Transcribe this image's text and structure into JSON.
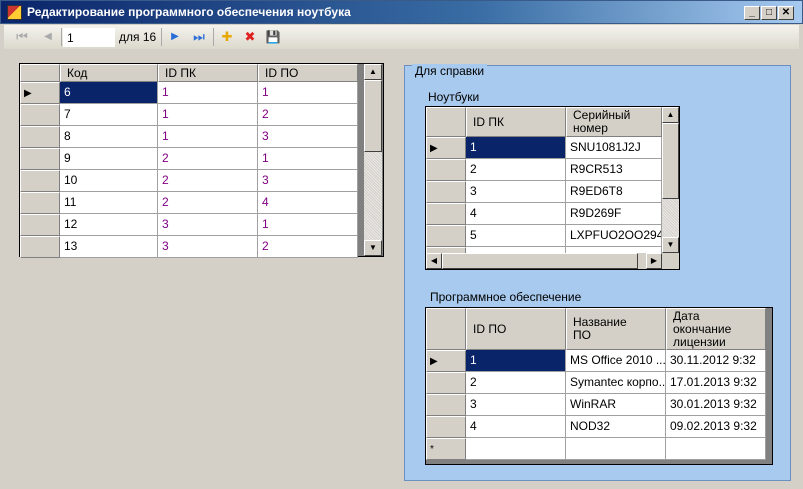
{
  "window": {
    "title": "Редактирование программного обеспечения ноутбука",
    "minimize": "_",
    "maximize": "□",
    "close": "✕"
  },
  "toolbar": {
    "first": "⏮",
    "prev": "◀",
    "position": "1",
    "of_label": "для 16",
    "next": "▶",
    "last": "⏭",
    "add": "✚",
    "delete": "✖",
    "save": "💾"
  },
  "main_grid": {
    "columns": [
      "Код",
      "ID ПК",
      "ID ПО"
    ],
    "rows": [
      [
        "6",
        "1",
        "1"
      ],
      [
        "7",
        "1",
        "2"
      ],
      [
        "8",
        "1",
        "3"
      ],
      [
        "9",
        "2",
        "1"
      ],
      [
        "10",
        "2",
        "3"
      ],
      [
        "11",
        "2",
        "4"
      ],
      [
        "12",
        "3",
        "1"
      ],
      [
        "13",
        "3",
        "2"
      ]
    ]
  },
  "reference": {
    "group_title": "Для справки",
    "laptops": {
      "label": "Ноутбуки",
      "columns": [
        "ID ПК",
        "Серийный номер"
      ],
      "rows": [
        [
          "1",
          "SNU1081J2J"
        ],
        [
          "2",
          "R9CR513"
        ],
        [
          "3",
          "R9ED6T8"
        ],
        [
          "4",
          "R9D269F"
        ],
        [
          "5",
          "LXPFUO2OO294..."
        ]
      ]
    },
    "software": {
      "label": "Программное обеспечение",
      "columns": [
        "ID ПО",
        "Название ПО",
        "Дата окончание лицензии"
      ],
      "rows": [
        [
          "1",
          "MS Office 2010 ...",
          "30.11.2012 9:32"
        ],
        [
          "2",
          "Symantec корпо...",
          "17.01.2013 9:32"
        ],
        [
          "3",
          "WinRAR",
          "30.01.2013 9:32"
        ],
        [
          "4",
          "NOD32",
          "09.02.2013 9:32"
        ]
      ],
      "new_row_marker": "*"
    }
  }
}
